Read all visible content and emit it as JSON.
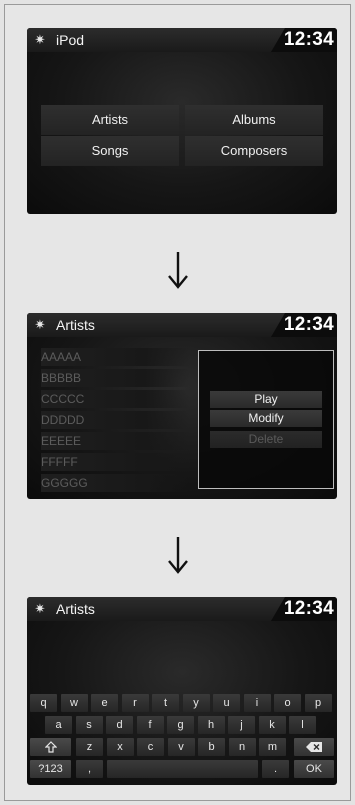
{
  "screen1": {
    "title": "iPod",
    "time": "12:34",
    "menu": [
      "Artists",
      "Albums",
      "Songs",
      "Composers"
    ]
  },
  "screen2": {
    "title": "Artists",
    "time": "12:34",
    "list": [
      "AAAAA",
      "BBBBB",
      "CCCCC",
      "DDDDD",
      "EEEEE",
      "FFFFF",
      "GGGGG"
    ],
    "popup": {
      "play": "Play",
      "modify": "Modify",
      "delete": "Delete"
    }
  },
  "screen3": {
    "title": "Artists",
    "time": "12:34",
    "keyboard": {
      "row1": [
        "q",
        "w",
        "e",
        "r",
        "t",
        "y",
        "u",
        "i",
        "o",
        "p"
      ],
      "row2": [
        "a",
        "s",
        "d",
        "f",
        "g",
        "h",
        "j",
        "k",
        "l"
      ],
      "row3": [
        "z",
        "x",
        "c",
        "v",
        "b",
        "n",
        "m"
      ],
      "mode_key": "?123",
      "comma_key": ",",
      "period_key": ".",
      "ok_key": "OK"
    }
  },
  "icons": {
    "settings": "gear-icon",
    "arrow": "down-arrow-icon",
    "shift": "shift-icon",
    "backspace": "backspace-icon"
  }
}
